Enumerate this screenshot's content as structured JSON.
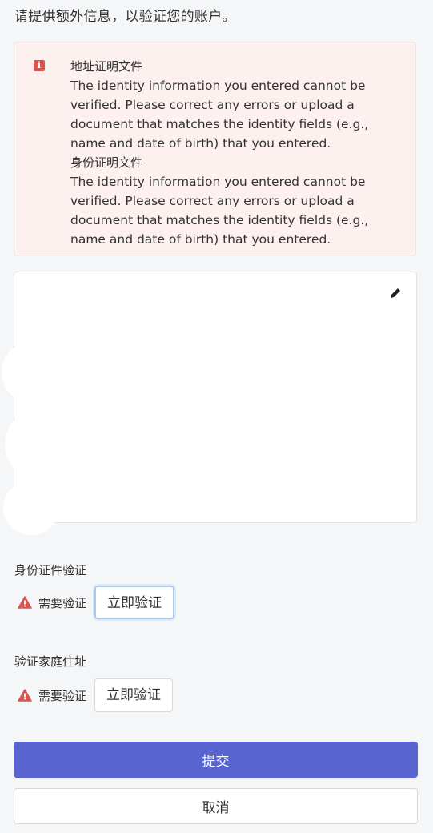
{
  "page": {
    "title": "请提供额外信息，以验证您的账户。"
  },
  "alert": {
    "icon": "info-icon",
    "color": "#d9534f",
    "items": [
      {
        "heading": "地址证明文件",
        "text": "The identity information you entered cannot be verified. Please correct any errors or upload a document that matches the identity fields (e.g., name and date of birth) that you entered."
      },
      {
        "heading": "身份证明文件",
        "text": "The identity information you entered cannot be verified. Please correct any errors or upload a document that matches the identity fields (e.g., name and date of birth) that you entered."
      }
    ]
  },
  "document_panel": {
    "edit_icon": "pencil-icon"
  },
  "id_verification": {
    "label": "身份证件验证",
    "status": "需要验证",
    "button": "立即验证"
  },
  "address_verification": {
    "label": "验证家庭住址",
    "status": "需要验证",
    "button": "立即验证"
  },
  "actions": {
    "submit": "提交",
    "cancel": "取消",
    "submit_color": "#5865d1"
  }
}
